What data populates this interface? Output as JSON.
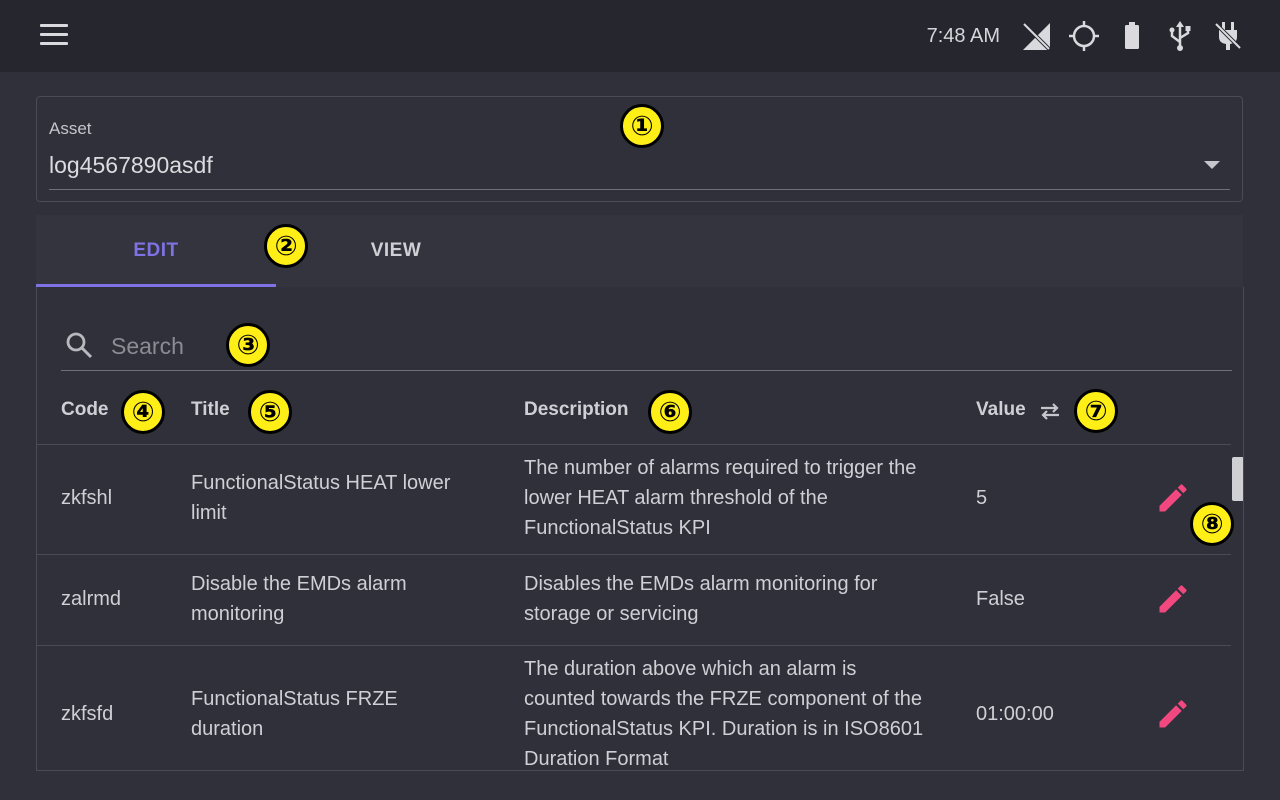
{
  "status_bar": {
    "time": "7:48 AM",
    "icons": [
      "no-signal-icon",
      "gps-icon",
      "battery-icon",
      "usb-icon",
      "power-off-icon"
    ]
  },
  "asset": {
    "label": "Asset",
    "value": "log4567890asdf"
  },
  "tabs": [
    {
      "label": "EDIT",
      "active": true
    },
    {
      "label": "VIEW",
      "active": false
    }
  ],
  "search": {
    "placeholder": "Search",
    "value": ""
  },
  "table": {
    "headers": {
      "code": "Code",
      "title": "Title",
      "description": "Description",
      "value": "Value"
    },
    "rows": [
      {
        "code": "zkfshl",
        "title": "FunctionalStatus HEAT lower limit",
        "description": "The number of alarms required to trigger the lower HEAT alarm threshold of the FunctionalStatus KPI",
        "value": "5"
      },
      {
        "code": "zalrmd",
        "title": "Disable the EMDs alarm monitoring",
        "description": "Disables the EMDs alarm monitoring for storage or servicing",
        "value": "False"
      },
      {
        "code": "zkfsfd",
        "title": "FunctionalStatus FRZE duration",
        "description": "The duration above which an alarm is counted towards the FRZE component of the FunctionalStatus KPI. Duration is in ISO8601 Duration Format",
        "value": "01:00:00"
      }
    ]
  },
  "annotations": [
    "①",
    "②",
    "③",
    "④",
    "⑤",
    "⑥",
    "⑦",
    "⑧"
  ],
  "colors": {
    "accent": "#7f72e4",
    "edit_icon": "#f0487f",
    "badge_fill": "#ffef16",
    "background": "#2f3039",
    "topbar": "#25262e"
  }
}
